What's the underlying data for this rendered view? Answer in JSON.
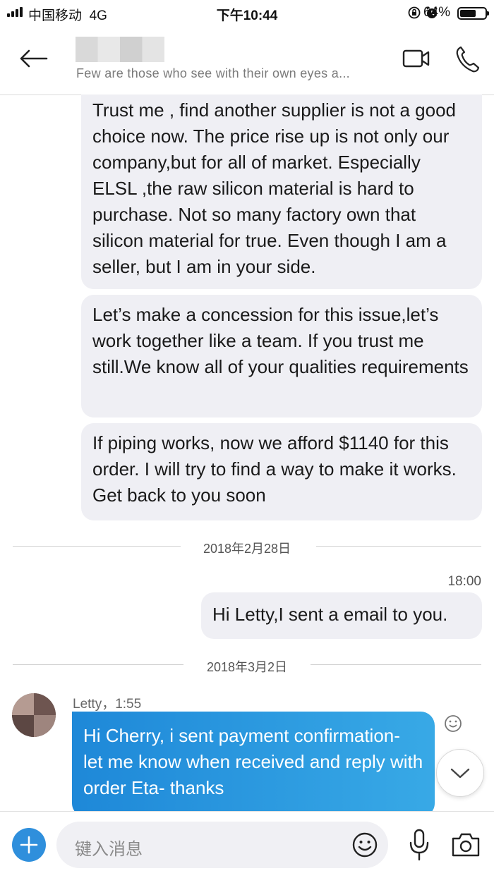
{
  "status_bar": {
    "carrier": "中国移动",
    "network": "4G",
    "time": "下午10:44",
    "battery_percent": "64%",
    "battery_level": 0.64,
    "icons": [
      "signal-icon",
      "lock-rotation-icon",
      "alarm-icon",
      "battery-icon"
    ]
  },
  "header": {
    "subtitle": "Few are those who see with their own eyes a...",
    "icons": [
      "back-arrow-icon",
      "video-call-icon",
      "phone-icon"
    ]
  },
  "messages_in": [
    "Trust me , find another supplier is not a good choice now. The price rise up is not only our company,but for all of market. Especially ELSL ,the raw silicon material is hard to purchase. Not so many factory own that silicon material for true. Even though I am a seller, but I am in your side.",
    "Let’s make a concession for this issue,let’s work together like a team. If you trust me still.We know all of your qualities requirements",
    "If piping works, now we afford $1140 for this order. I will try to find a way to make it works. Get back to you soon"
  ],
  "date_divider_1": "2018年2月28日",
  "outgoing": {
    "time": "18:00",
    "text": "Hi Letty,I sent a email to you."
  },
  "date_divider_2": "2018年3月2日",
  "incoming_last": {
    "sender": "Letty，1:55",
    "text": "Hi Cherry, i sent payment confirmation- let me know when received and reply with order Eta- thanks"
  },
  "composer": {
    "placeholder": "键入消息",
    "icons": [
      "add-icon",
      "emoji-icon",
      "microphone-icon",
      "camera-icon"
    ]
  },
  "colors": {
    "accent_blue": "#1e88d8",
    "bubble_gray": "#efeff4"
  }
}
